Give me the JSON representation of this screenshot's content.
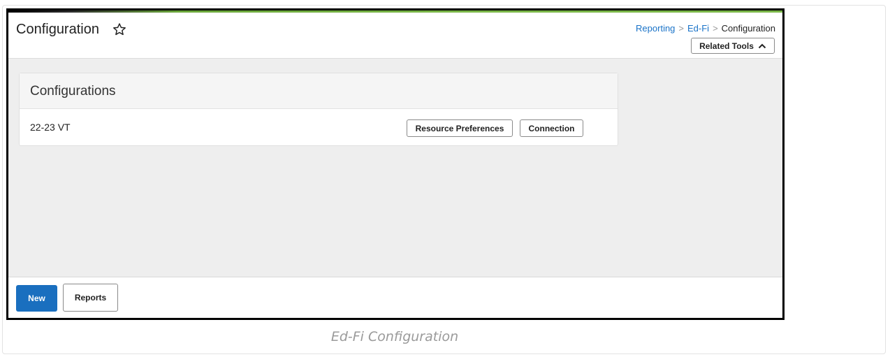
{
  "header": {
    "title": "Configuration",
    "star_icon": "star-outline-icon",
    "breadcrumb": {
      "items": [
        "Reporting",
        "Ed-Fi",
        "Configuration"
      ],
      "separator": ">"
    },
    "related_tools_label": "Related Tools",
    "related_tools_icon": "chevron-up-icon"
  },
  "panel": {
    "title": "Configurations",
    "rows": [
      {
        "name": "22-23 VT",
        "buttons": [
          "Resource Preferences",
          "Connection"
        ]
      }
    ]
  },
  "footer": {
    "new_label": "New",
    "reports_label": "Reports"
  },
  "caption": "Ed-Fi Configuration",
  "colors": {
    "link": "#1a73c8",
    "primary_button": "#1a6fbf",
    "accent": "#7ab648",
    "content_bg": "#eeeeee"
  }
}
